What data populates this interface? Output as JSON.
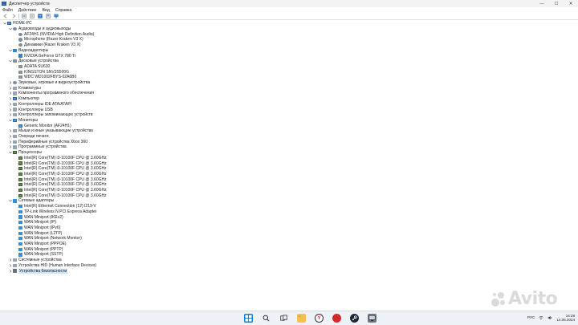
{
  "window": {
    "title": "Диспетчер устройств",
    "minimize_glyph": "—",
    "maximize_glyph": "☐",
    "close_glyph": "✕"
  },
  "menu": {
    "items": [
      "Файл",
      "Действие",
      "Вид",
      "Справка"
    ]
  },
  "toolbar": {
    "icons": [
      "back-icon",
      "forward-icon",
      "properties-icon",
      "list-icon",
      "help-icon",
      "view-icon",
      "monitor-icon"
    ]
  },
  "tree": {
    "root": "HOME-PC",
    "rows": [
      {
        "level": 0,
        "exp": "v",
        "icon": "computer",
        "label": "HOME-PC"
      },
      {
        "level": 1,
        "exp": "v",
        "icon": "audio",
        "label": "Аудиовходы и аудиовыходы"
      },
      {
        "level": 2,
        "exp": "",
        "icon": "audio",
        "label": "AF24H1 (NVIDIA High Definition Audio)"
      },
      {
        "level": 2,
        "exp": "",
        "icon": "audio",
        "label": "Microphone (Razer Kraken V3 X)"
      },
      {
        "level": 2,
        "exp": "",
        "icon": "audio",
        "label": "Динамики (Razer Kraken V3 X)"
      },
      {
        "level": 1,
        "exp": "v",
        "icon": "video",
        "label": "Видеоадаптеры"
      },
      {
        "level": 2,
        "exp": "",
        "icon": "video",
        "label": "NVIDIA GeForce GTX 780 Ti"
      },
      {
        "level": 1,
        "exp": "v",
        "icon": "disk",
        "label": "Дисковые устройства"
      },
      {
        "level": 2,
        "exp": "",
        "icon": "disk",
        "label": "ADATA SU630"
      },
      {
        "level": 2,
        "exp": "",
        "icon": "disk",
        "label": "KINGSTON SNV3S500G"
      },
      {
        "level": 2,
        "exp": "",
        "icon": "disk",
        "label": "WDC WD1002FBYS-02A6B0"
      },
      {
        "level": 1,
        "exp": ">",
        "icon": "audio",
        "label": "Звуковые, игровые и видеоустройства"
      },
      {
        "level": 1,
        "exp": ">",
        "icon": "generic",
        "label": "Клавиатуры"
      },
      {
        "level": 1,
        "exp": ">",
        "icon": "generic",
        "label": "Компоненты программного обеспечения"
      },
      {
        "level": 1,
        "exp": ">",
        "icon": "computer",
        "label": "Компьютер"
      },
      {
        "level": 1,
        "exp": ">",
        "icon": "generic",
        "label": "Контроллеры IDE ATA/ATAPI"
      },
      {
        "level": 1,
        "exp": ">",
        "icon": "generic",
        "label": "Контроллеры USB"
      },
      {
        "level": 1,
        "exp": ">",
        "icon": "generic",
        "label": "Контроллеры запоминающих устройств"
      },
      {
        "level": 1,
        "exp": "v",
        "icon": "monitor",
        "label": "Мониторы"
      },
      {
        "level": 2,
        "exp": "",
        "icon": "monitor",
        "label": "Generic Monitor (AF24H1)"
      },
      {
        "level": 1,
        "exp": ">",
        "icon": "generic",
        "label": "Мыши и иные указывающие устройства"
      },
      {
        "level": 1,
        "exp": ">",
        "icon": "generic",
        "label": "Очереди печати"
      },
      {
        "level": 1,
        "exp": ">",
        "icon": "generic",
        "label": "Периферийные устройства Xbox 360"
      },
      {
        "level": 1,
        "exp": ">",
        "icon": "generic",
        "label": "Программные устройства"
      },
      {
        "level": 1,
        "exp": "v",
        "icon": "cpu",
        "label": "Процессоры"
      },
      {
        "level": 2,
        "exp": "",
        "icon": "cpu",
        "label": "Intel(R) Core(TM) i3-10100F CPU @ 3.60GHz"
      },
      {
        "level": 2,
        "exp": "",
        "icon": "cpu",
        "label": "Intel(R) Core(TM) i3-10100F CPU @ 3.60GHz"
      },
      {
        "level": 2,
        "exp": "",
        "icon": "cpu",
        "label": "Intel(R) Core(TM) i3-10100F CPU @ 3.60GHz"
      },
      {
        "level": 2,
        "exp": "",
        "icon": "cpu",
        "label": "Intel(R) Core(TM) i3-10100F CPU @ 3.60GHz"
      },
      {
        "level": 2,
        "exp": "",
        "icon": "cpu",
        "label": "Intel(R) Core(TM) i3-10100F CPU @ 3.60GHz"
      },
      {
        "level": 2,
        "exp": "",
        "icon": "cpu",
        "label": "Intel(R) Core(TM) i3-10100F CPU @ 3.60GHz"
      },
      {
        "level": 2,
        "exp": "",
        "icon": "cpu",
        "label": "Intel(R) Core(TM) i3-10100F CPU @ 3.60GHz"
      },
      {
        "level": 2,
        "exp": "",
        "icon": "cpu",
        "label": "Intel(R) Core(TM) i3-10100F CPU @ 3.60GHz"
      },
      {
        "level": 1,
        "exp": "v",
        "icon": "net",
        "label": "Сетевые адаптеры"
      },
      {
        "level": 2,
        "exp": "",
        "icon": "net",
        "label": "Intel(R) Ethernet Connection (12) I219-V"
      },
      {
        "level": 2,
        "exp": "",
        "icon": "net",
        "label": "TP-Link Wireless N PCI Express Adapter"
      },
      {
        "level": 2,
        "exp": "",
        "icon": "net",
        "label": "WAN Miniport (IKEv2)"
      },
      {
        "level": 2,
        "exp": "",
        "icon": "net",
        "label": "WAN Miniport (IP)"
      },
      {
        "level": 2,
        "exp": "",
        "icon": "net",
        "label": "WAN Miniport (IPv6)"
      },
      {
        "level": 2,
        "exp": "",
        "icon": "net",
        "label": "WAN Miniport (L2TP)"
      },
      {
        "level": 2,
        "exp": "",
        "icon": "net",
        "label": "WAN Miniport (Network Monitor)"
      },
      {
        "level": 2,
        "exp": "",
        "icon": "net",
        "label": "WAN Miniport (PPPOE)"
      },
      {
        "level": 2,
        "exp": "",
        "icon": "net",
        "label": "WAN Miniport (PPTP)"
      },
      {
        "level": 2,
        "exp": "",
        "icon": "net",
        "label": "WAN Miniport (SSTP)"
      },
      {
        "level": 1,
        "exp": ">",
        "icon": "generic",
        "label": "Системные устройства"
      },
      {
        "level": 1,
        "exp": ">",
        "icon": "generic",
        "label": "Устройства HID (Human Interface Devices)"
      },
      {
        "level": 1,
        "exp": ">",
        "icon": "security",
        "label": "Устройства безопасности",
        "selected": true
      }
    ]
  },
  "taskbar": {
    "apps": [
      "windows-start-icon",
      "search-icon",
      "task-view-icon",
      "file-explorer-icon",
      "yandex-browser-icon",
      "red-app-icon",
      "steam-icon",
      "device-manager-icon"
    ],
    "yandex_glyph": "Y",
    "lang": "РУС",
    "time": "14:28",
    "date": "14.06.2024"
  },
  "watermark": {
    "text": "Avito"
  },
  "colors": {
    "selection": "#cce4f7",
    "accent": "#0a78d7"
  }
}
